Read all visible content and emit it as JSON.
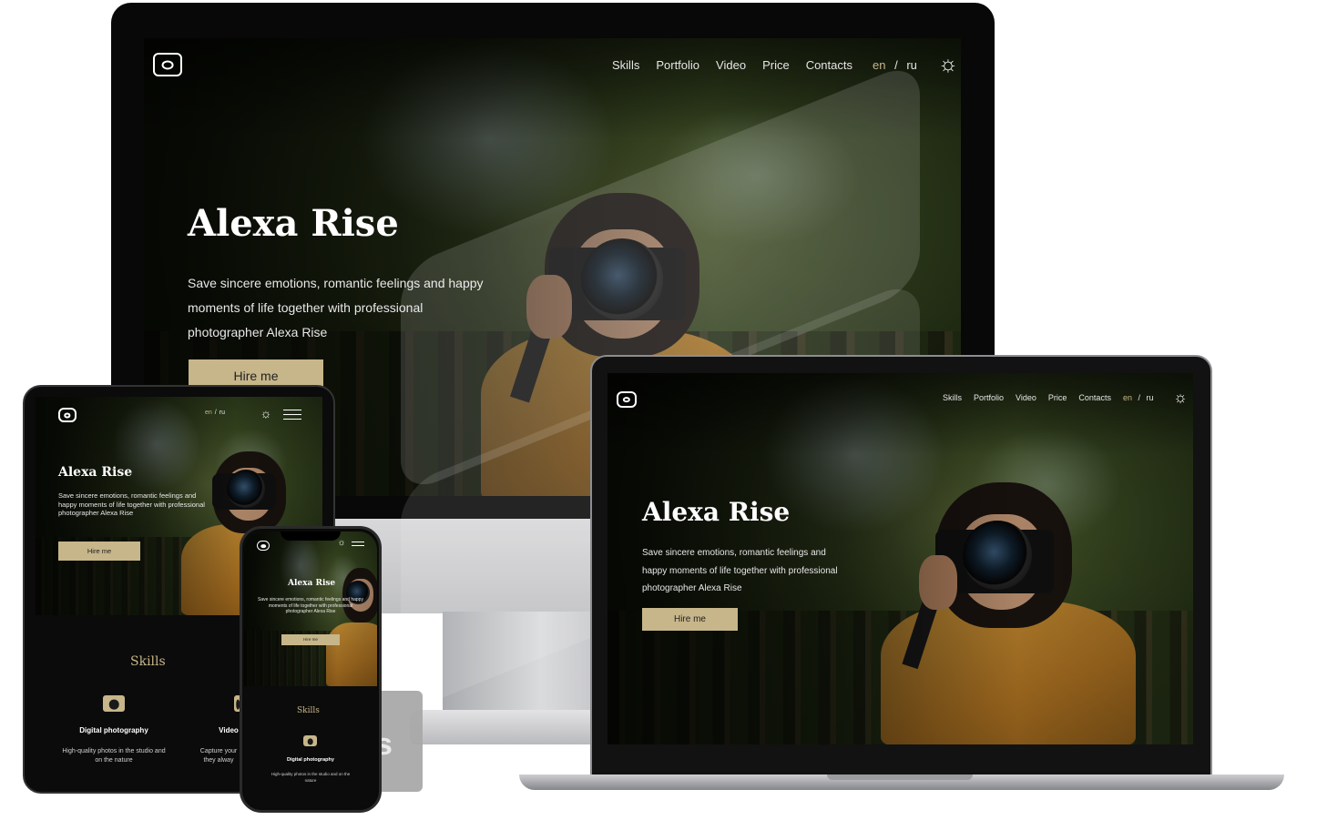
{
  "site": {
    "name": "Alexa Rise",
    "tagline": "Save sincere emotions, romantic feelings and happy moments of life together with professional photographer Alexa Rise",
    "cta": "Hire me",
    "nav": [
      "Skills",
      "Portfolio",
      "Video",
      "Price",
      "Contacts"
    ],
    "lang_en": "en",
    "lang_sep": "/",
    "lang_ru": "ru",
    "accent_color": "#c7b68a",
    "theme_icon": "sun-icon",
    "menu_icon": "hamburger-icon",
    "logo_icon": "camera-logo-icon"
  },
  "skills": {
    "heading": "Skills",
    "items": [
      {
        "title": "Digital photography",
        "text": "High-quality photos in the studio and on the nature",
        "icon": "camera-icon"
      },
      {
        "title": "Video",
        "text": "Capture your they alway",
        "icon": "video-icon"
      }
    ]
  },
  "watermark_letter": "s",
  "devices": [
    "imac",
    "macbook",
    "ipad",
    "iphone"
  ]
}
